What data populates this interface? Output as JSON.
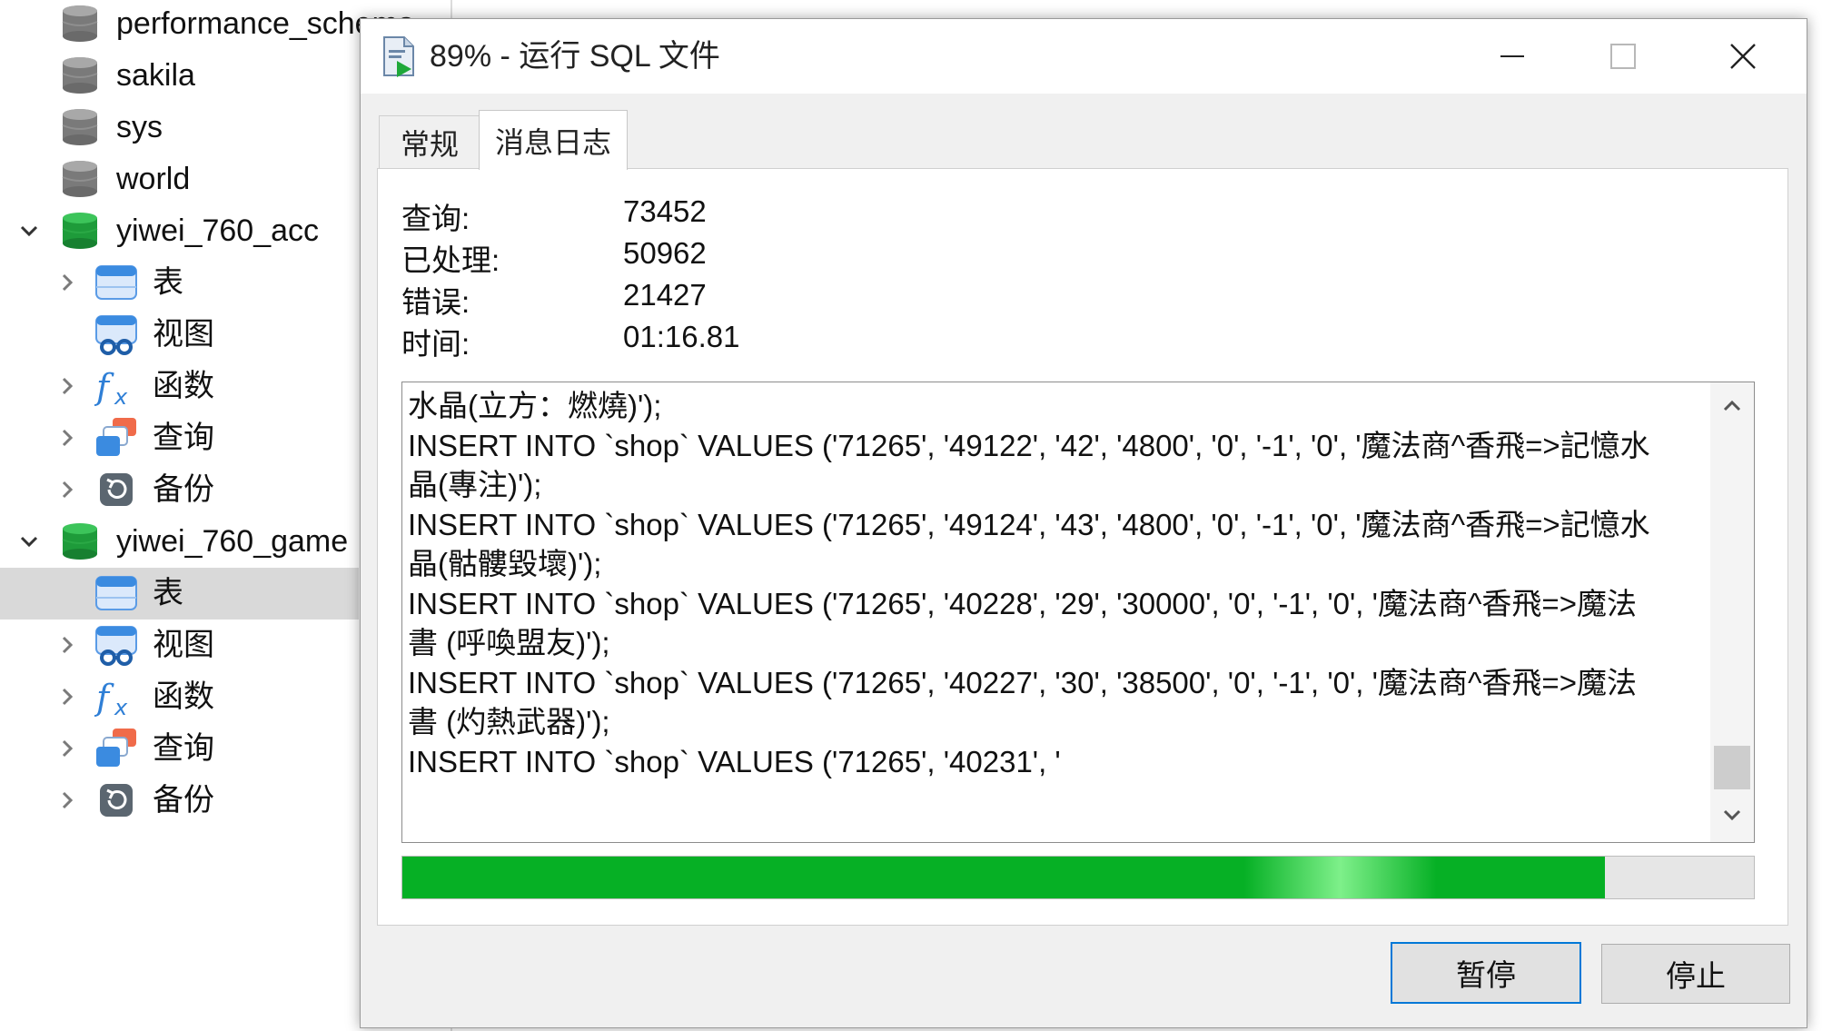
{
  "sidebar": {
    "items": [
      {
        "label": "performance_schema",
        "type": "db-grey",
        "chevron": "none"
      },
      {
        "label": "sakila",
        "type": "db-grey",
        "chevron": "none"
      },
      {
        "label": "sys",
        "type": "db-grey",
        "chevron": "none"
      },
      {
        "label": "world",
        "type": "db-grey",
        "chevron": "none"
      },
      {
        "label": "yiwei_760_acc",
        "type": "db-green",
        "chevron": "down"
      },
      {
        "label": "表",
        "type": "table",
        "chevron": "right"
      },
      {
        "label": "视图",
        "type": "view",
        "chevron": "none"
      },
      {
        "label": "函数",
        "type": "function",
        "chevron": "right"
      },
      {
        "label": "查询",
        "type": "query",
        "chevron": "right"
      },
      {
        "label": "备份",
        "type": "backup",
        "chevron": "right"
      },
      {
        "label": "yiwei_760_game",
        "type": "db-green",
        "chevron": "down"
      },
      {
        "label": "表",
        "type": "table",
        "chevron": "none",
        "selected": true
      },
      {
        "label": "视图",
        "type": "view",
        "chevron": "right"
      },
      {
        "label": "函数",
        "type": "function",
        "chevron": "right"
      },
      {
        "label": "查询",
        "type": "query",
        "chevron": "right"
      },
      {
        "label": "备份",
        "type": "backup",
        "chevron": "right"
      }
    ]
  },
  "dialog": {
    "title": "89% - 运行 SQL 文件",
    "icons": {
      "title": "sql-file-run-icon",
      "minimize": "minimize-icon",
      "maximize": "maximize-icon",
      "close": "close-icon"
    },
    "tabs": [
      {
        "label": "常规",
        "active": false
      },
      {
        "label": "消息日志",
        "active": true
      }
    ],
    "stats": [
      {
        "label": "查询:",
        "value": "73452"
      },
      {
        "label": "已处理:",
        "value": "50962"
      },
      {
        "label": "错误:",
        "value": "21427"
      },
      {
        "label": "时间:",
        "value": "01:16.81"
      }
    ],
    "log_lines": [
      "水晶(立方：燃燒)');",
      "INSERT INTO `shop` VALUES ('71265', '49122', '42', '4800', '0', '-1', '0', '魔法商^香飛=>記憶水",
      "晶(專注)');",
      "INSERT INTO `shop` VALUES ('71265', '49124', '43', '4800', '0', '-1', '0', '魔法商^香飛=>記憶水",
      "晶(骷髏毀壞)');",
      "INSERT INTO `shop` VALUES ('71265', '40228', '29', '30000', '0', '-1', '0', '魔法商^香飛=>魔法",
      "書 (呼喚盟友)');",
      "INSERT INTO `shop` VALUES ('71265', '40227', '30', '38500', '0', '-1', '0', '魔法商^香飛=>魔法",
      "書 (灼熱武器)');",
      "INSERT INTO `shop` VALUES ('71265', '40231', '"
    ],
    "progress_fraction": 0.89,
    "buttons": {
      "pause": "暂停",
      "stop": "停止"
    },
    "colors": {
      "progress": "#06b025",
      "default_button_border": "#0078d7"
    }
  }
}
